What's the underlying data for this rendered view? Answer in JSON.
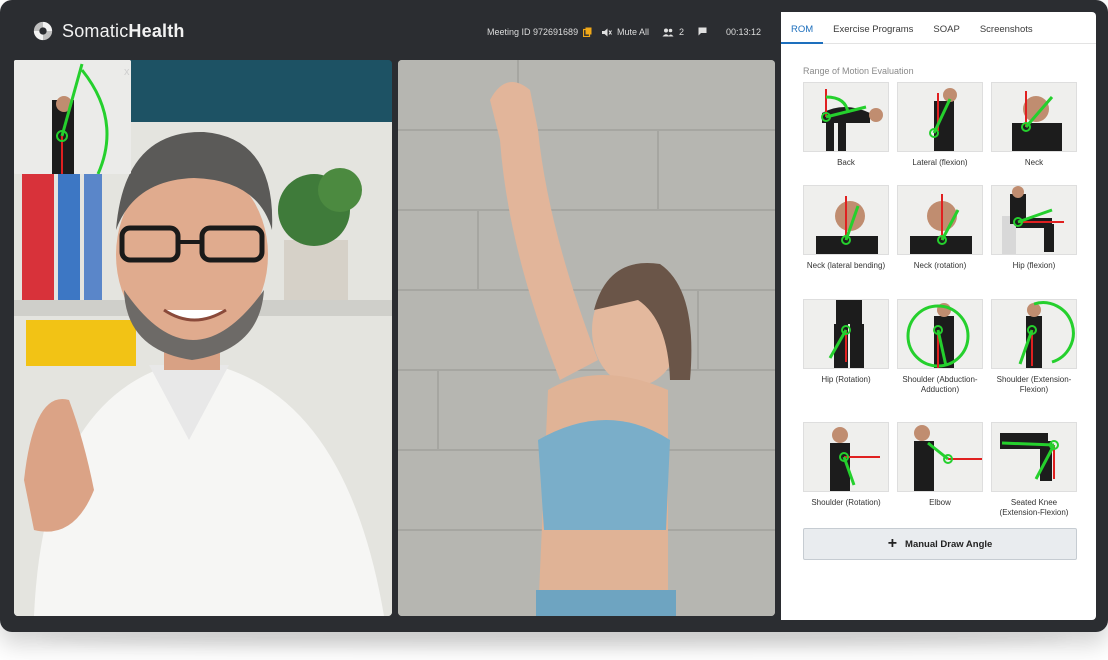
{
  "app": {
    "brand_light": "Somatic",
    "brand_bold": "Health"
  },
  "header": {
    "meeting_label": "Meeting ID 972691689",
    "mute_label": "Mute All",
    "participants": "2",
    "timer": "00:13:12"
  },
  "pip": {
    "close_label": "x"
  },
  "tabs": [
    "ROM",
    "Exercise Programs",
    "SOAP",
    "Screenshots"
  ],
  "rom": {
    "title": "Range of Motion Evaluation",
    "items": [
      {
        "label": "Back"
      },
      {
        "label": "Lateral (flexion)"
      },
      {
        "label": "Neck"
      },
      {
        "label": "Neck (lateral bending)"
      },
      {
        "label": "Neck (rotation)"
      },
      {
        "label": "Hip (flexion)"
      },
      {
        "label": "Hip (Rotation)"
      },
      {
        "label": "Shoulder (Abduction-Adduction)"
      },
      {
        "label": "Shoulder (Extension-Flexion)"
      },
      {
        "label": "Shoulder (Rotation)"
      },
      {
        "label": "Elbow"
      },
      {
        "label": "Seated Knee (Extension-Flexion)"
      }
    ],
    "manual_button": "Manual Draw Angle"
  },
  "colors": {
    "accent": "#1d6fbd",
    "overlay_green": "#25d02d",
    "overlay_red": "#e02020"
  },
  "icons": [
    "logo-icon",
    "copy-icon",
    "speaker-icon",
    "users-icon",
    "chat-icon",
    "plus-icon"
  ]
}
